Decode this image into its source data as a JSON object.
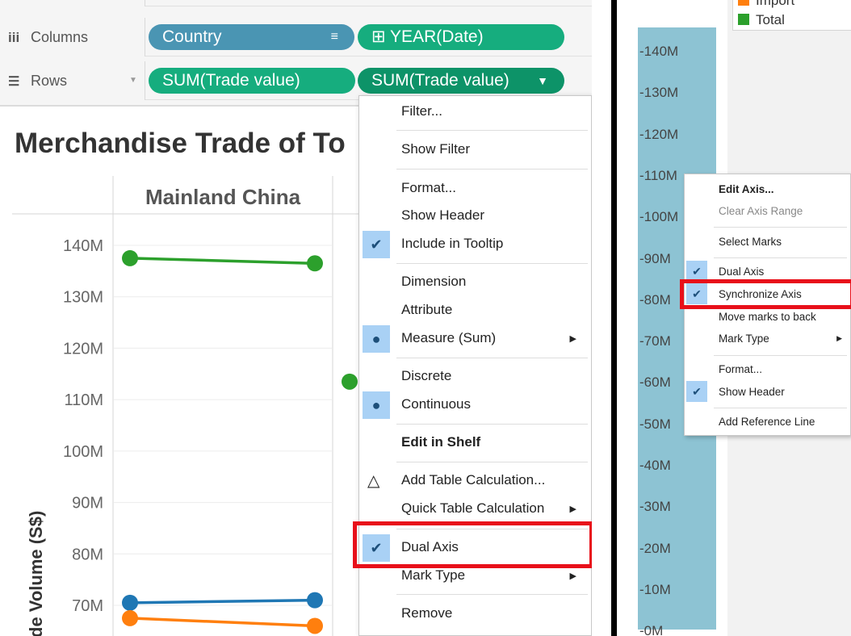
{
  "shelves": {
    "columns_label": "Columns",
    "rows_label": "Rows",
    "columns_icon": "columns-icon",
    "rows_icon": "rows-icon",
    "columns_pills": [
      {
        "label": "Country",
        "color": "#4a95b3",
        "icon": "sort-icon"
      },
      {
        "label": "⊞ YEAR(Date)",
        "color": "#16ad7e"
      }
    ],
    "rows_pills": [
      {
        "label": "SUM(Trade value)",
        "color": "#16ad7e"
      },
      {
        "label": "SUM(Trade value)",
        "color": "#0d9368",
        "icon": "dropdown-caret-icon"
      }
    ]
  },
  "viz": {
    "title": "Merchandise Trade of To",
    "pane_header": "Mainland China",
    "y_axis_label": "de Volume (S$)"
  },
  "chart_data": {
    "type": "line",
    "ylim": [
      65000000,
      145000000
    ],
    "y_ticks": [
      "140M",
      "130M",
      "120M",
      "110M",
      "100M",
      "90M",
      "80M",
      "70M"
    ],
    "series": [
      {
        "color": "#2ca02c",
        "values": [
          137500000,
          136500000
        ]
      },
      {
        "color": "#1f77b4",
        "values": [
          70500000,
          71000000
        ]
      },
      {
        "color": "#ff7f0e",
        "values": [
          67500000,
          66000000
        ]
      }
    ],
    "extra_points": [
      {
        "color": "#2ca02c",
        "value": 113500000
      }
    ],
    "grid": true
  },
  "menu_left": {
    "items": [
      {
        "label": "Filter...",
        "section": 0
      },
      {
        "label": "Show Filter",
        "section": 1
      },
      {
        "label": "Format...",
        "section": 2
      },
      {
        "label": "Show Header",
        "section": 2
      },
      {
        "label": "Include in Tooltip",
        "section": 2,
        "check": "checkmark-icon"
      },
      {
        "label": "Dimension",
        "section": 3
      },
      {
        "label": "Attribute",
        "section": 3
      },
      {
        "label": "Measure (Sum)",
        "section": 3,
        "check": "bullet-icon",
        "submenu": true
      },
      {
        "label": "Discrete",
        "section": 4
      },
      {
        "label": "Continuous",
        "section": 4,
        "check": "bullet-icon"
      },
      {
        "label": "Edit in Shelf",
        "section": 5,
        "bold": true
      },
      {
        "label": "Add Table Calculation...",
        "section": 6,
        "icon": "delta-icon"
      },
      {
        "label": "Quick Table Calculation",
        "section": 6,
        "submenu": true
      },
      {
        "label": "Dual Axis",
        "section": 7,
        "check": "checkmark-icon",
        "highlight": true
      },
      {
        "label": "Mark Type",
        "section": 7,
        "submenu": true
      },
      {
        "label": "Remove",
        "section": 8
      }
    ]
  },
  "right_panel": {
    "legend": [
      {
        "label": "Import",
        "color": "#ff7f0e"
      },
      {
        "label": "Total",
        "color": "#2ca02c"
      }
    ],
    "axis_ticks": [
      "140M",
      "130M",
      "120M",
      "110M",
      "100M",
      "90M",
      "80M",
      "70M",
      "60M",
      "50M",
      "40M",
      "30M",
      "20M",
      "10M",
      "0M"
    ],
    "bar_color": "#8dc3d3"
  },
  "menu_right": {
    "items": [
      {
        "label": "Edit Axis...",
        "bold": true
      },
      {
        "label": "Clear Axis Range",
        "disabled": true
      },
      {
        "label": "Select Marks"
      },
      {
        "label": "Dual Axis",
        "check": "checkmark-icon"
      },
      {
        "label": "Synchronize Axis",
        "check": "checkmark-icon",
        "highlight": true
      },
      {
        "label": "Move marks to back"
      },
      {
        "label": "Mark Type",
        "submenu": true
      },
      {
        "label": "Format..."
      },
      {
        "label": "Show Header",
        "check": "checkmark-icon"
      },
      {
        "label": "Add Reference Line"
      }
    ]
  },
  "colors": {
    "highlight_box": "#e8101a",
    "check_bg": "#a9d1f5"
  }
}
